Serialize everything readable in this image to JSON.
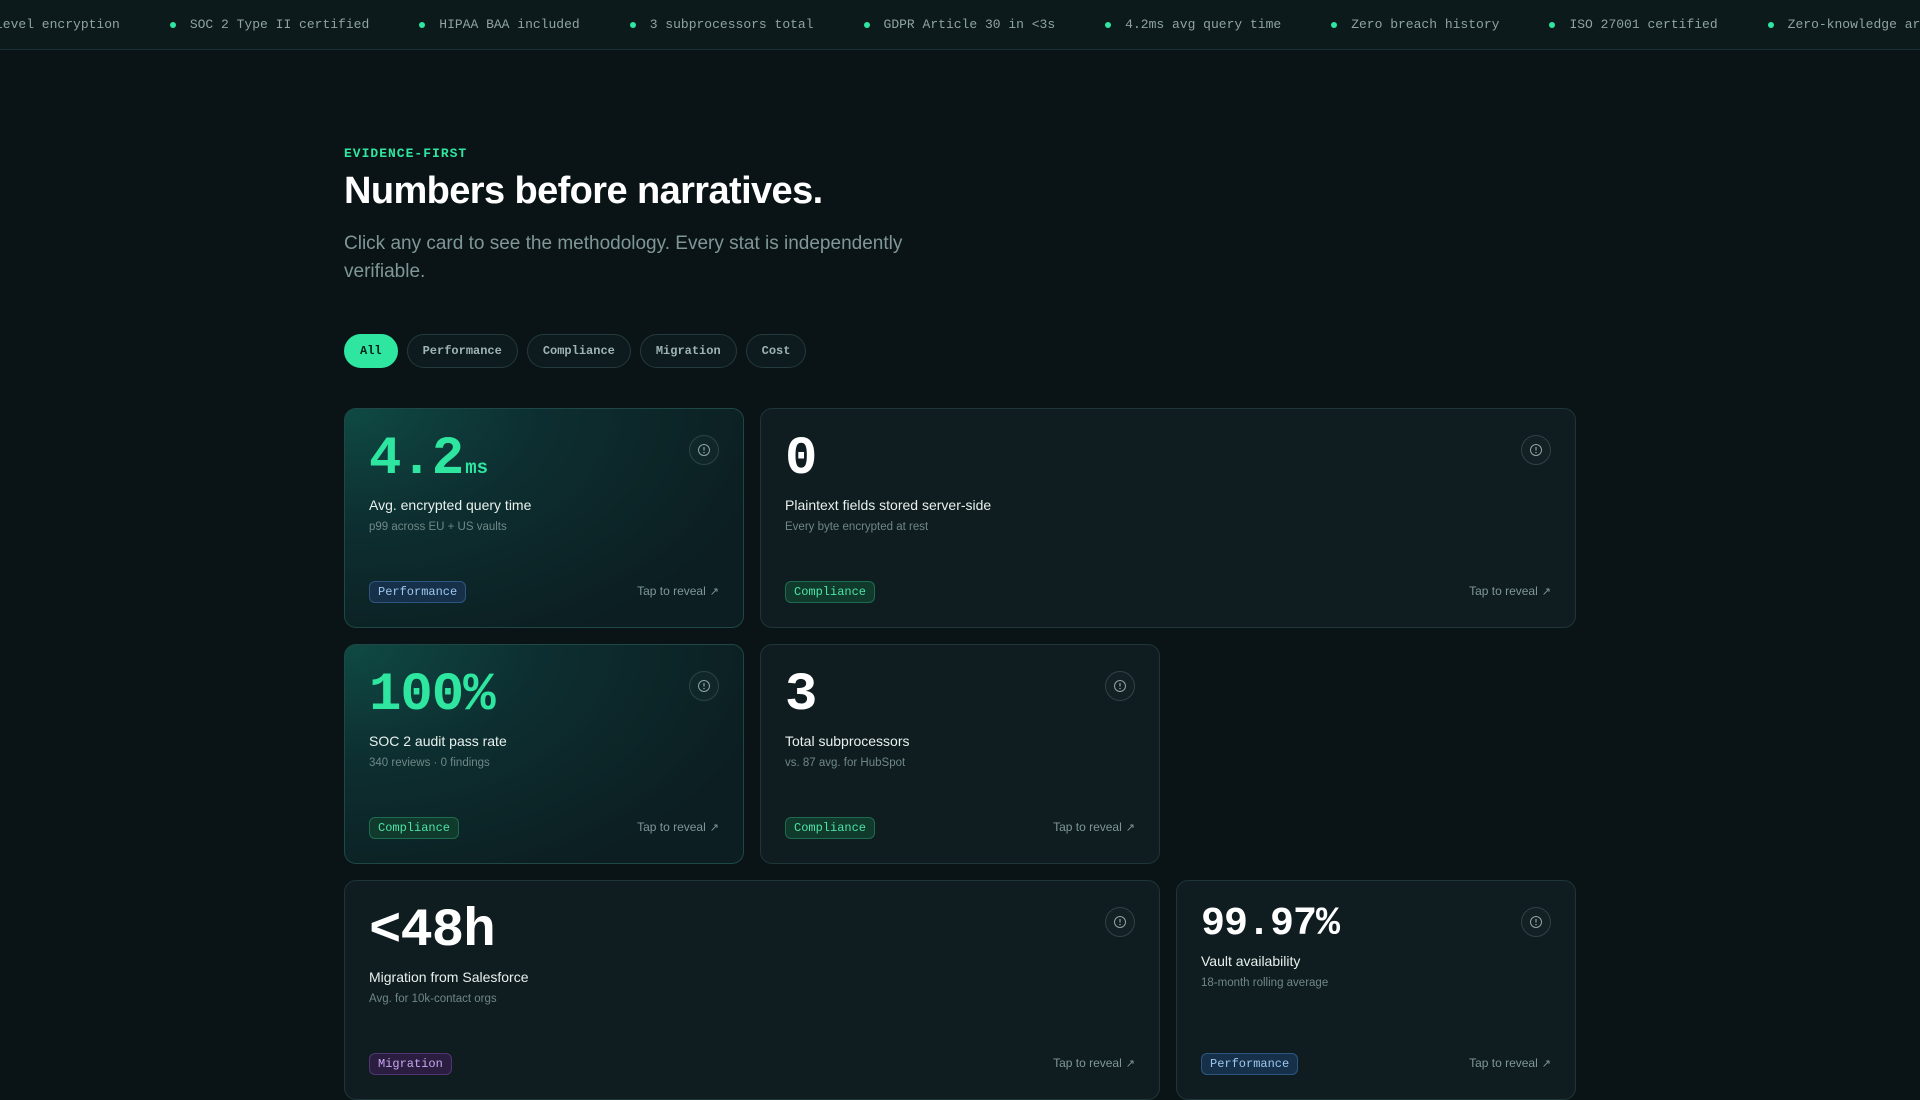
{
  "ticker": [
    "level encryption",
    "SOC 2 Type II certified",
    "HIPAA BAA included",
    "3 subprocessors total",
    "GDPR Article 30 in <3s",
    "4.2ms avg query time",
    "Zero breach history",
    "ISO 27001 certified",
    "Zero-knowledge architecture"
  ],
  "header": {
    "eyebrow": "EVIDENCE-FIRST",
    "title": "Numbers before narratives.",
    "subtitle": "Click any card to see the methodology. Every stat is independently verifiable."
  },
  "filters": [
    "All",
    "Performance",
    "Compliance",
    "Migration",
    "Cost"
  ],
  "active_filter": "All",
  "colors": {
    "accent": "#2ee6a0",
    "background": "#0a1316",
    "card": "#0f1d20"
  },
  "reveal_label": "Tap to reveal",
  "reveal_icon": "arrow-up-right-icon",
  "info_icon": "info-icon",
  "cards": [
    {
      "value": "4.2",
      "unit": "ms",
      "label": "Avg. encrypted query time",
      "note": "p99 across EU + US vaults",
      "tag": "Performance",
      "highlight": true
    },
    {
      "value": "0",
      "unit": "",
      "label": "Plaintext fields stored server-side",
      "note": "Every byte encrypted at rest",
      "tag": "Compliance",
      "highlight": false
    },
    {
      "value": "100%",
      "unit": "",
      "label": "SOC 2 audit pass rate",
      "note": "340 reviews · 0 findings",
      "tag": "Compliance",
      "highlight": true
    },
    {
      "value": "3",
      "unit": "",
      "label": "Total subprocessors",
      "note": "vs. 87 avg. for HubSpot",
      "tag": "Compliance",
      "highlight": false
    },
    {
      "value": "<48h",
      "unit": "",
      "label": "Migration from Salesforce",
      "note": "Avg. for 10k-contact orgs",
      "tag": "Migration",
      "highlight": false
    },
    {
      "value": "99.97%",
      "unit": "",
      "label": "Vault availability",
      "note": "18-month rolling average",
      "tag": "Performance",
      "highlight": false
    }
  ]
}
